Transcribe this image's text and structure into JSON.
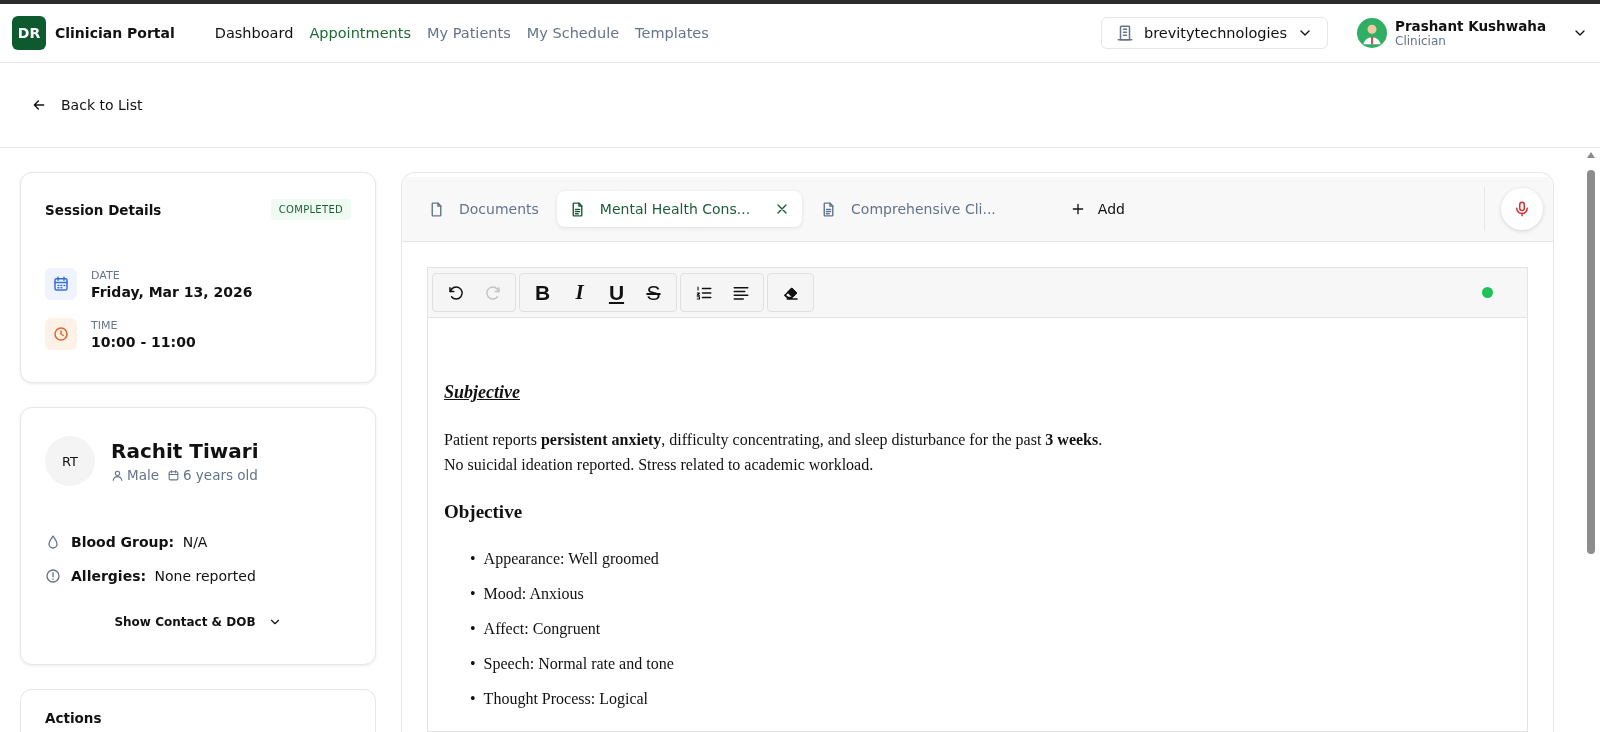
{
  "header": {
    "logo": "DR",
    "app_name": "Clinician Portal",
    "nav": [
      {
        "label": "Dashboard",
        "selected": false,
        "hovered": true
      },
      {
        "label": "Appointments",
        "selected": true,
        "hovered": false
      },
      {
        "label": "My Patients",
        "selected": false,
        "hovered": false
      },
      {
        "label": "My Schedule",
        "selected": false,
        "hovered": false
      },
      {
        "label": "Templates",
        "selected": false,
        "hovered": false
      }
    ],
    "org": "brevitytechnologies",
    "user": {
      "name": "Prashant Kushwaha",
      "role": "Clinician"
    }
  },
  "back": "Back to List",
  "session": {
    "title": "Session Details",
    "status": "COMPLETED",
    "date_label": "DATE",
    "date": "Friday, Mar 13, 2026",
    "time_label": "TIME",
    "time": "10:00 - 11:00"
  },
  "patient": {
    "initials": "RT",
    "name": "Rachit Tiwari",
    "gender": "Male",
    "age": "6 years old",
    "fields": [
      {
        "kind": "blood",
        "label": "Blood Group:",
        "value": "N/A"
      },
      {
        "kind": "allergy",
        "label": "Allergies:",
        "value": "None reported"
      }
    ],
    "toggle": "Show Contact & DOB"
  },
  "actions": {
    "title": "Actions"
  },
  "editor": {
    "tabs": [
      {
        "label": "Documents",
        "selected": false,
        "closable": false
      },
      {
        "label": "Mental Health Cons...",
        "selected": true,
        "closable": true
      },
      {
        "label": "Comprehensive Cli...",
        "selected": false,
        "closable": false
      }
    ],
    "add": "Add",
    "toolbar": [
      [
        {
          "kind": "undo",
          "disabled": false
        },
        {
          "kind": "redo",
          "disabled": true
        }
      ],
      [
        {
          "kind": "bold",
          "label": "B",
          "disabled": false
        },
        {
          "kind": "italic",
          "label": "I",
          "disabled": false
        },
        {
          "kind": "underline",
          "label": "U",
          "disabled": false
        },
        {
          "kind": "strike",
          "label": "S",
          "disabled": false
        }
      ],
      [
        {
          "kind": "ordered-list",
          "disabled": false
        },
        {
          "kind": "align",
          "disabled": false
        }
      ],
      [
        {
          "kind": "clear",
          "disabled": false
        }
      ]
    ],
    "synced": true,
    "content": [
      {
        "kind": "title",
        "text": "Subjective"
      },
      {
        "kind": "paragraph",
        "lines": [
          "Patient reports **persistent anxiety**, difficulty concentrating, and sleep disturbance for the past **3 weeks**.",
          "No suicidal ideation reported. Stress related to academic workload."
        ]
      },
      {
        "kind": "heading",
        "text": "Objective"
      },
      {
        "kind": "bullets",
        "marker": "•",
        "items": [
          "Appearance: Well groomed",
          "Mood: Anxious",
          "Affect: Congruent",
          "Speech: Normal rate and tone",
          "Thought Process: Logical"
        ]
      }
    ]
  }
}
